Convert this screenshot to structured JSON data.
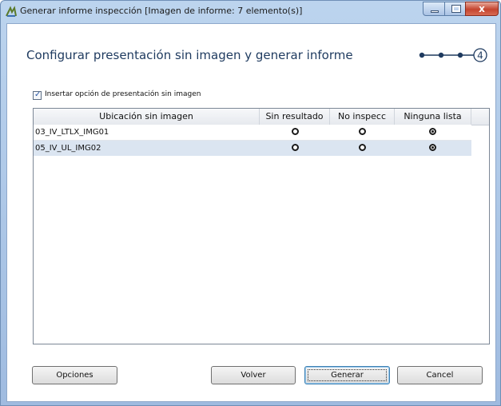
{
  "window": {
    "title": "Generar informe inspección  [Imagen de informe: 7 elemento(s)]",
    "close_glyph": "x"
  },
  "heading": "Configurar presentación sin imagen y generar informe",
  "steps": {
    "current": "4"
  },
  "option": {
    "label": "Insertar opción de presentación sin imagen",
    "checked": true
  },
  "table": {
    "columns": [
      "Ubicación sin imagen",
      "Sin resultado",
      "No inspecc",
      "Ninguna lista"
    ],
    "rows": [
      {
        "location": "03_IV_LTLX_IMG01",
        "selected": "Ninguna lista"
      },
      {
        "location": "05_IV_UL_IMG02",
        "selected": "Ninguna lista"
      }
    ]
  },
  "buttons": {
    "options": "Opciones",
    "back": "Volver",
    "generate": "Generar",
    "cancel": "Cancel"
  },
  "colors": {
    "accent": "#1e3a5f",
    "selected_row": "#dbe5f1"
  }
}
